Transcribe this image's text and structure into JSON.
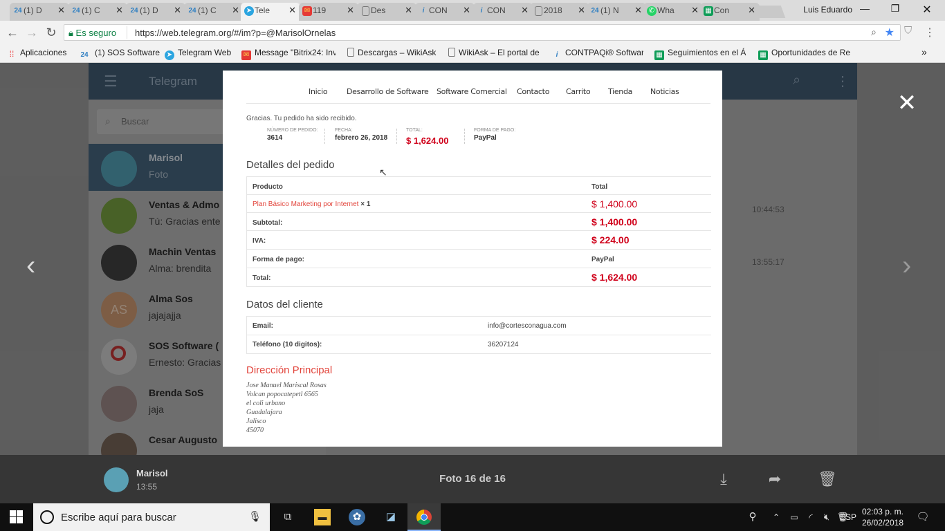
{
  "browser": {
    "tabs": [
      {
        "icon": "24",
        "label": "(1) D"
      },
      {
        "icon": "24",
        "label": "(1) C"
      },
      {
        "icon": "24",
        "label": "(1) D"
      },
      {
        "icon": "24",
        "label": "(1) C"
      },
      {
        "icon": "telegram",
        "label": "Tele"
      },
      {
        "icon": "mail",
        "label": "119"
      },
      {
        "icon": "doc",
        "label": "Des"
      },
      {
        "icon": "i",
        "label": "CON"
      },
      {
        "icon": "i",
        "label": "CON"
      },
      {
        "icon": "doc",
        "label": "2018"
      },
      {
        "icon": "24",
        "label": "(1) N"
      },
      {
        "icon": "whatsapp",
        "label": "Wha"
      },
      {
        "icon": "sheet",
        "label": "Con"
      }
    ],
    "user": "Luis Eduardo",
    "secure_label": "Es seguro",
    "url": "https://web.telegram.org/#/im?p=@MarisolOrnelas",
    "bookmarks": [
      "Aplicaciones",
      "(1) SOS Software",
      "Telegram Web",
      "Message \"Bitrix24: Inv",
      "Descargas – WikiAsk",
      "WikiAsk – El portal de",
      "CONTPAQi® Softwar",
      "Seguimientos en el Á",
      "Oportunidades de Re"
    ]
  },
  "telegram": {
    "title": "Telegram",
    "search_placeholder": "Buscar",
    "chats": [
      {
        "name": "Marisol",
        "preview": "Foto",
        "time": ""
      },
      {
        "name": "Ventas & Admo",
        "preview": "Tú: Gracias ente",
        "time": "10:44:53"
      },
      {
        "name": "Machin Ventas",
        "preview": "Alma: brendita",
        "time": "13:55:17"
      },
      {
        "name": "Alma Sos",
        "preview": "jajajajja",
        "initials": "AS"
      },
      {
        "name": "SOS Software (",
        "preview": "Ernesto: Gracias"
      },
      {
        "name": "Brenda SoS",
        "preview": "jaja"
      },
      {
        "name": "Cesar Augusto",
        "preview": ""
      }
    ]
  },
  "photo": {
    "nav": [
      "Inicio",
      "Desarrollo de Software",
      "Software Comercial",
      "Contacto",
      "Carrito",
      "Tienda",
      "Noticias"
    ],
    "thanks": "Gracias. Tu pedido ha sido recibido.",
    "summary": {
      "order_label": "NÚMERO DE PEDIDO:",
      "order": "3614",
      "date_label": "FECHA:",
      "date": "febrero 26, 2018",
      "total_label": "TOTAL:",
      "total": "$ 1,624.00",
      "pay_label": "FORMA DE PAGO:",
      "pay": "PayPal"
    },
    "details_title": "Detalles del pedido",
    "col_product": "Producto",
    "col_total": "Total",
    "product_name": "Plan Básico Marketing por Internet",
    "product_qty": "× 1",
    "product_price": "$ 1,400.00",
    "subtotal_label": "Subtotal:",
    "subtotal": "$ 1,400.00",
    "iva_label": "IVA:",
    "iva": "$ 224.00",
    "payment_label": "Forma de pago:",
    "payment": "PayPal",
    "total_label": "Total:",
    "total": "$ 1,624.00",
    "client_title": "Datos del cliente",
    "email_label": "Email:",
    "email": "info@cortesconagua.com",
    "phone_label": "Teléfono (10 digitos):",
    "phone": "36207124",
    "address_title": "Dirección Principal",
    "address": [
      "Jose Manuel Mariscal Rosas",
      "Volcan popocatepetl 6565",
      "el coli urbano",
      "Guadalajara",
      "Jalisco",
      "45070"
    ]
  },
  "viewer": {
    "author": "Marisol",
    "time": "13:55",
    "counter": "Foto 16 de 16"
  },
  "taskbar": {
    "search_placeholder": "Escribe aquí para buscar",
    "lang": "ESP",
    "time": "02:03 p. m.",
    "date": "26/02/2018"
  }
}
